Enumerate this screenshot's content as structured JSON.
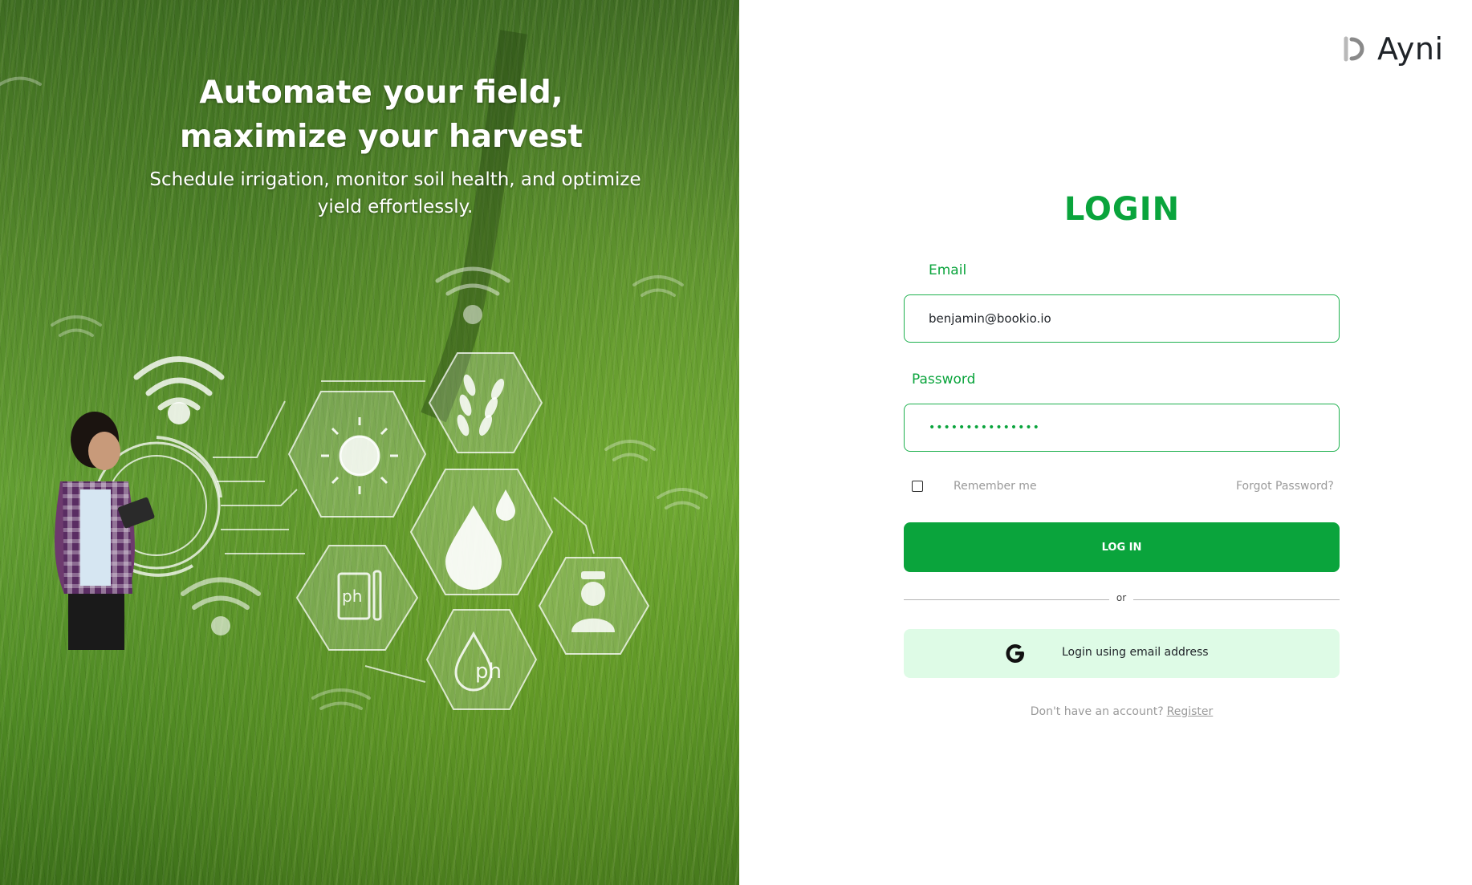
{
  "hero": {
    "title_line1": "Automate your field,",
    "title_line2": "maximize your harvest",
    "subtitle": "Schedule irrigation, monitor soil health, and optimize yield effortlessly.",
    "icon_labels": {
      "ph1": "ph",
      "ph2": "ph"
    }
  },
  "brand": {
    "name": "Ayni",
    "icon": "ayni-logo-icon"
  },
  "login": {
    "title": "LOGIN",
    "email_label": "Email",
    "email_value": "benjamin@bookio.io",
    "password_label": "Password",
    "password_value": "•••••••••••••••",
    "remember_label": "Remember me",
    "remember_checked": false,
    "forgot_label": "Forgot Password?",
    "submit_label": "LOG IN",
    "divider_text": "or",
    "google_label": "Login using email address",
    "google_icon": "google-icon",
    "no_account_text": "Don't have an account?",
    "register_label": "Register"
  },
  "colors": {
    "accent": "#0aa43c",
    "google_button_bg": "#defbe6",
    "muted_text": "#9a9a9a"
  }
}
